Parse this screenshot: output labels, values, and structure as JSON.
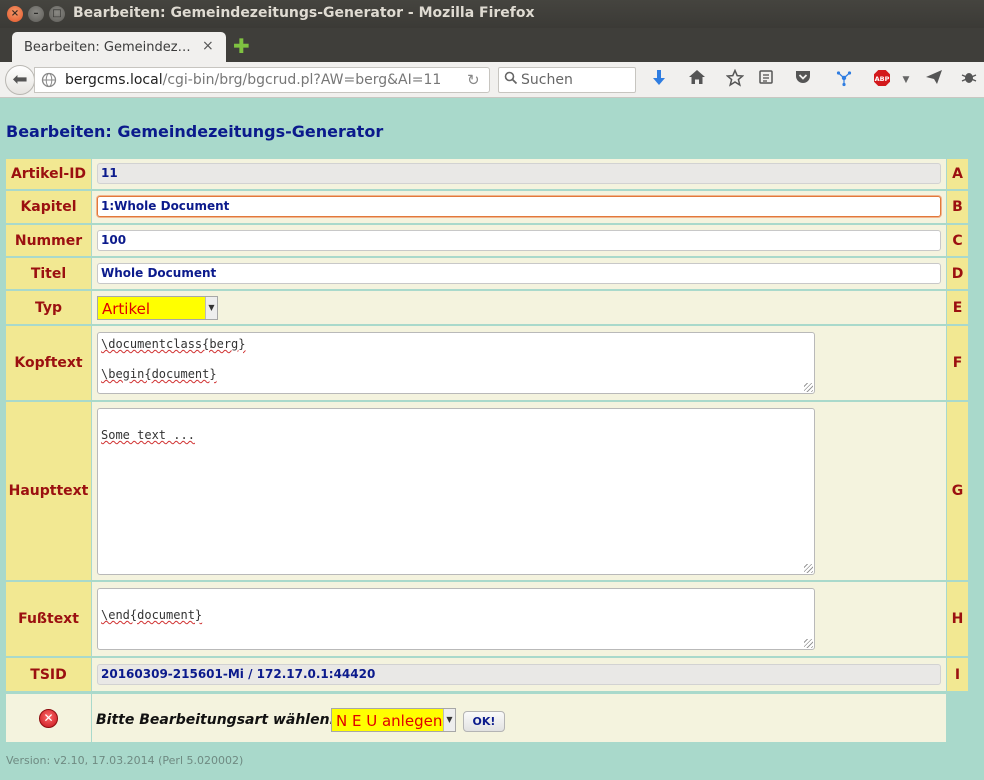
{
  "window": {
    "title": "Bearbeiten: Gemeindezeitungs-Generator - Mozilla Firefox",
    "close_glyph": "×",
    "min_glyph": "–",
    "max_glyph": "□"
  },
  "tabs": [
    {
      "label": "Bearbeiten: Gemeindez…",
      "close": "×",
      "active": true
    }
  ],
  "newtab_glyph": "✚",
  "nav": {
    "back_glyph": "⬅",
    "url_host": "bergcms.local",
    "url_path": "/cgi-bin/brg/bgcrud.pl?AW=berg&AI=11",
    "reload_glyph": "↻",
    "search_placeholder": "Suchen",
    "toolbar_icons": [
      "download-icon",
      "home-icon",
      "bookmark-star-icon",
      "reading-list-icon",
      "pocket-icon",
      "sync-icon",
      "adblock-icon",
      "send-icon",
      "bug-icon"
    ],
    "abp_text": "ABP"
  },
  "page": {
    "heading": "Bearbeiten: Gemeindezeitungs-Generator",
    "fields": [
      {
        "label": "Artikel-ID",
        "letter": "A",
        "value": "11"
      },
      {
        "label": "Kapitel",
        "letter": "B",
        "value": "1:Whole Document"
      },
      {
        "label": "Nummer",
        "letter": "C",
        "value": "100"
      },
      {
        "label": "Titel",
        "letter": "D",
        "value": "Whole Document"
      },
      {
        "label": "Typ",
        "letter": "E",
        "value": "Artikel"
      },
      {
        "label": "Kopftext",
        "letter": "F",
        "lines": [
          "\\documentclass{berg}",
          "",
          "\\begin{document}"
        ]
      },
      {
        "label": "Haupttext",
        "letter": "G",
        "lines": [
          "",
          "Some text ..."
        ]
      },
      {
        "label": "Fußtext",
        "letter": "H",
        "lines": [
          "",
          "\\end{document}"
        ]
      },
      {
        "label": "TSID",
        "letter": "I",
        "value": "20160309-215601-Mi / 172.17.0.1:44420"
      }
    ],
    "action": {
      "prompt": "Bitte Bearbeitungsart wählen:",
      "mode": "N E U anlegen",
      "ok": "OK!"
    },
    "version": "Version: v2.10, 17.03.2014 (Perl 5.020002)"
  },
  "colors": {
    "page_bg": "#a9d9cb",
    "label_bg": "#f2e892",
    "label_text": "#9b1010",
    "value_bg": "#f4f3de",
    "field_text": "#0b1a8c",
    "select_bg": "#ffff00",
    "select_text": "#e00000"
  }
}
